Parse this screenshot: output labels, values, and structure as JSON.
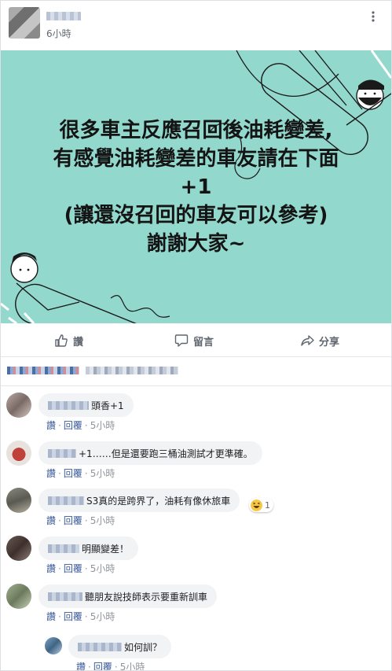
{
  "post": {
    "timestamp": "6小時",
    "more_label": "•••"
  },
  "image": {
    "bg_color": "#93d8cd",
    "lines": [
      "很多車主反應召回後油耗變差,",
      "有感覺油耗變差的車友請在下面",
      "+1",
      "(讓還沒召回的車友可以參考)",
      "謝謝大家~"
    ]
  },
  "actions": {
    "like": "讚",
    "comment": "留言",
    "share": "分享"
  },
  "comments": [
    {
      "text": "頭香+1",
      "like": "讚",
      "reply": "回覆",
      "time": "5小時"
    },
    {
      "text": "+1……但是還要跑三桶油測試才更準確。",
      "like": "讚",
      "reply": "回覆",
      "time": "5小時"
    },
    {
      "text": "S3真的是跨界了，油耗有像休旅車",
      "like": "讚",
      "reply": "回覆",
      "time": "5小時",
      "reaction_count": "1"
    },
    {
      "text": "明顯變差！",
      "like": "讚",
      "reply": "回覆",
      "time": "5小時"
    },
    {
      "text": "聽朋友說技師表示要重新訓車",
      "like": "讚",
      "reply": "回覆",
      "time": "5小時"
    },
    {
      "text": "如何訓？",
      "like": "讚",
      "reply": "回覆",
      "time": "5小時"
    }
  ]
}
